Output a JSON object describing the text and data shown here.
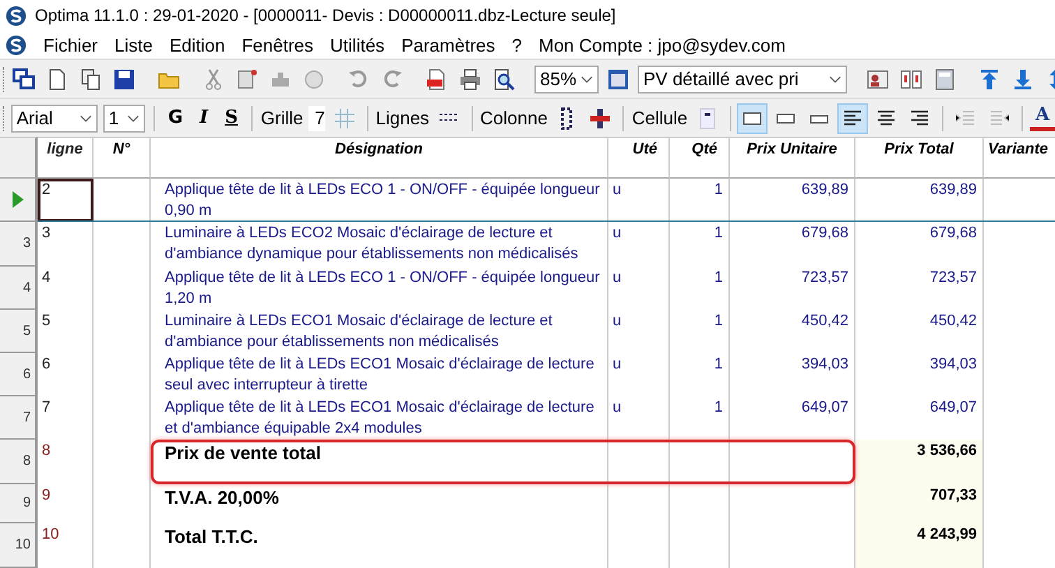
{
  "window": {
    "title": "Optima 11.1.0 : 29-01-2020 - [0000011- Devis : D00000011.dbz-Lecture seule]"
  },
  "menu": [
    "Fichier",
    "Liste",
    "Edition",
    "Fenêtres",
    "Utilités",
    "Paramètres",
    "?",
    "Mon Compte : jpo@sydev.com"
  ],
  "toolbar": {
    "zoom": "85%",
    "view": "PV détaillé avec pri"
  },
  "format_bar": {
    "font": "Arial",
    "size": "1",
    "bold": "G",
    "italic": "I",
    "underline": "S",
    "grid_label": "Grille",
    "grid_value": "7",
    "lines_label": "Lignes",
    "column_label": "Colonne",
    "cell_label": "Cellule",
    "font_color": "A"
  },
  "table": {
    "columns": [
      "ligne",
      "N°",
      "Désignation",
      "Uté",
      "Qté",
      "Prix Unitaire",
      "Prix Total",
      "Variante"
    ],
    "rows": [
      {
        "kind": "item",
        "selected": true,
        "highlighted": false,
        "ligne": "2",
        "designation": "Applique tête de lit à LEDs ECO 1 - ON/OFF - équipée longueur 0,90 m",
        "ute": "u",
        "qte": "1",
        "unit_price": "639,89",
        "total": "639,89"
      },
      {
        "kind": "item",
        "selected": false,
        "highlighted": false,
        "header": "3",
        "ligne": "3",
        "designation": "Luminaire à LEDs ECO2 Mosaic d'éclairage de lecture et d'ambiance dynamique pour établissements non médicalisés",
        "ute": "u",
        "qte": "1",
        "unit_price": "679,68",
        "total": "679,68"
      },
      {
        "kind": "item",
        "selected": false,
        "highlighted": false,
        "header": "4",
        "ligne": "4",
        "designation": "Applique tête de lit à LEDs ECO 1 - ON/OFF - équipée longueur 1,20 m",
        "ute": "u",
        "qte": "1",
        "unit_price": "723,57",
        "total": "723,57"
      },
      {
        "kind": "item",
        "selected": false,
        "highlighted": false,
        "header": "5",
        "ligne": "5",
        "designation": "Luminaire à LEDs ECO1 Mosaic d'éclairage de lecture et d'ambiance pour établissements non médicalisés",
        "ute": "u",
        "qte": "1",
        "unit_price": "450,42",
        "total": "450,42"
      },
      {
        "kind": "item",
        "selected": false,
        "highlighted": false,
        "header": "6",
        "ligne": "6",
        "designation": "Applique tête de lit à LEDs ECO1 Mosaic d'éclairage de lecture seul avec interrupteur à tirette",
        "ute": "u",
        "qte": "1",
        "unit_price": "394,03",
        "total": "394,03"
      },
      {
        "kind": "item",
        "selected": false,
        "highlighted": false,
        "header": "7",
        "ligne": "7",
        "designation": "Applique tête de lit à LEDs ECO1 Mosaic d'éclairage de lecture et d'ambiance équipable 2x4 modules",
        "ute": "u",
        "qte": "1",
        "unit_price": "649,07",
        "total": "649,07"
      },
      {
        "kind": "total",
        "selected": false,
        "highlighted": true,
        "header": "8",
        "ligne": "8",
        "designation": "Prix de vente total",
        "total": "3 536,66"
      },
      {
        "kind": "total",
        "selected": false,
        "highlighted": false,
        "header": "9",
        "ligne": "9",
        "designation": "T.V.A. 20,00%",
        "total": "707,33"
      },
      {
        "kind": "total",
        "selected": false,
        "highlighted": false,
        "header": "10",
        "ligne": "10",
        "designation": "Total  T.T.C.",
        "total": "4 243,99"
      }
    ]
  }
}
